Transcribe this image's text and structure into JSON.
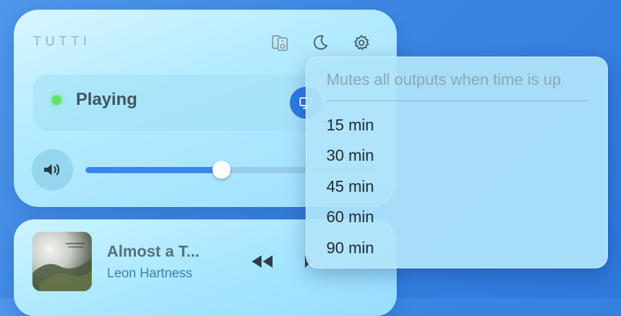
{
  "app": {
    "name": "TUTTI"
  },
  "header": {
    "icons": [
      "speakers-icon",
      "moon-icon",
      "gear-icon"
    ]
  },
  "status": {
    "label": "Playing",
    "indicator_color": "#62e06f"
  },
  "output_button": {
    "icon": "display-icon",
    "color": "#2f7ae6"
  },
  "volume": {
    "icon": "speaker-volume-icon",
    "level": 0.47
  },
  "now_playing": {
    "title": "Almost a T...",
    "artist": "Leon Hartness",
    "controls": [
      "rewind-icon",
      "play-icon"
    ]
  },
  "sleep_timer_menu": {
    "header": "Mutes all outputs when time is up",
    "options": [
      "15 min",
      "30 min",
      "45 min",
      "60 min",
      "90 min"
    ]
  },
  "colors": {
    "accent": "#3b86e8",
    "background": "#3c86e2"
  }
}
